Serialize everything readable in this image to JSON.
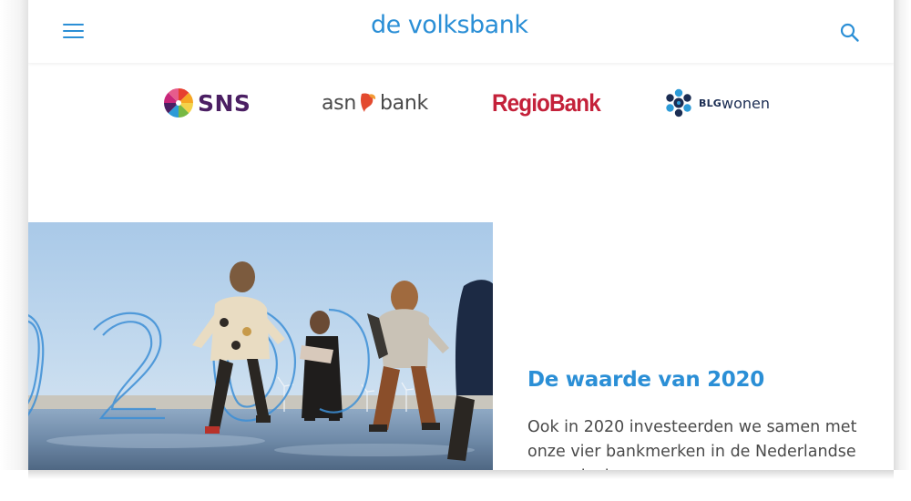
{
  "header": {
    "brand_name": "de volksbank",
    "menu_icon": "hamburger-menu-icon",
    "search_icon": "search-icon",
    "accent_color": "#2b8fd6"
  },
  "brands": [
    {
      "name": "SNS",
      "icon": "sns-pinwheel-logo",
      "color": "#4b1f63"
    },
    {
      "name_part1": "asn",
      "name_part2": "bank",
      "icon": "asn-leaf-logo",
      "color": "#4a4a4a"
    },
    {
      "name": "RegioBank",
      "color": "#c4213a"
    },
    {
      "name_bold": "BLG",
      "name_light": "wonen",
      "icon": "blg-dots-logo",
      "color": "#1b2d53"
    }
  ],
  "story": {
    "title": "De waarde van 2020",
    "body": "Ook in 2020 investeerden we samen met onze vier bankmerken in de Nederlandse samenleving."
  }
}
